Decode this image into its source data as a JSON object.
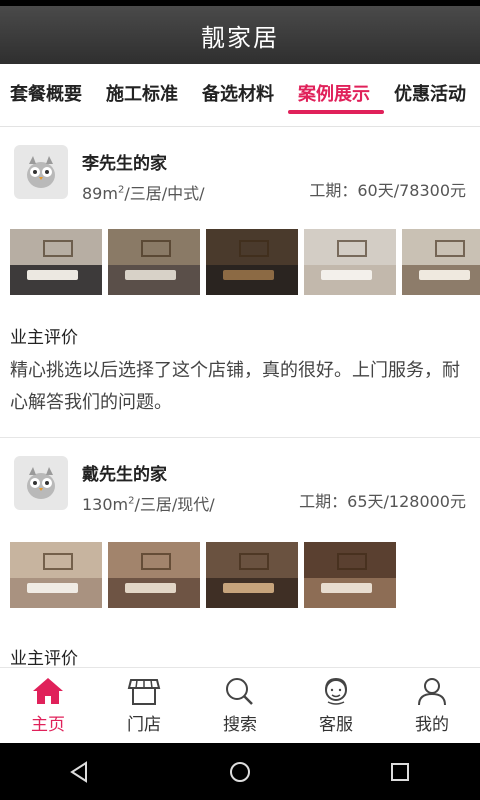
{
  "app": {
    "title": "靓家居"
  },
  "tabs": [
    {
      "label": "套餐概要"
    },
    {
      "label": "施工标准"
    },
    {
      "label": "备选材料"
    },
    {
      "label": "案例展示",
      "active": true
    },
    {
      "label": "优惠活动"
    }
  ],
  "cases": [
    {
      "name": "李先生的家",
      "area": "89m",
      "area_sup": "2",
      "spec_rest": "/三居/中式/",
      "duration": "工期：60天/78300元",
      "photo_count": 5,
      "review_title": "业主评价",
      "review_text": "精心挑选以后选择了这个店铺，真的很好。上门服务，耐心解答我们的问题。"
    },
    {
      "name": "戴先生的家",
      "area": "130m",
      "area_sup": "2",
      "spec_rest": "/三居/现代/",
      "duration": "工期：65天/128000元",
      "photo_count": 4,
      "review_title": "业主评价"
    }
  ],
  "bottom_nav": [
    {
      "label": "主页",
      "icon": "home-icon",
      "active": true
    },
    {
      "label": "门店",
      "icon": "store-icon"
    },
    {
      "label": "搜索",
      "icon": "search-icon"
    },
    {
      "label": "客服",
      "icon": "customer-service-icon"
    },
    {
      "label": "我的",
      "icon": "user-icon"
    }
  ],
  "system_nav": [
    "back-icon",
    "home-circle-icon",
    "recents-icon"
  ],
  "colors": {
    "accent": "#e0215a",
    "titlebar": "#3a3a3a"
  }
}
